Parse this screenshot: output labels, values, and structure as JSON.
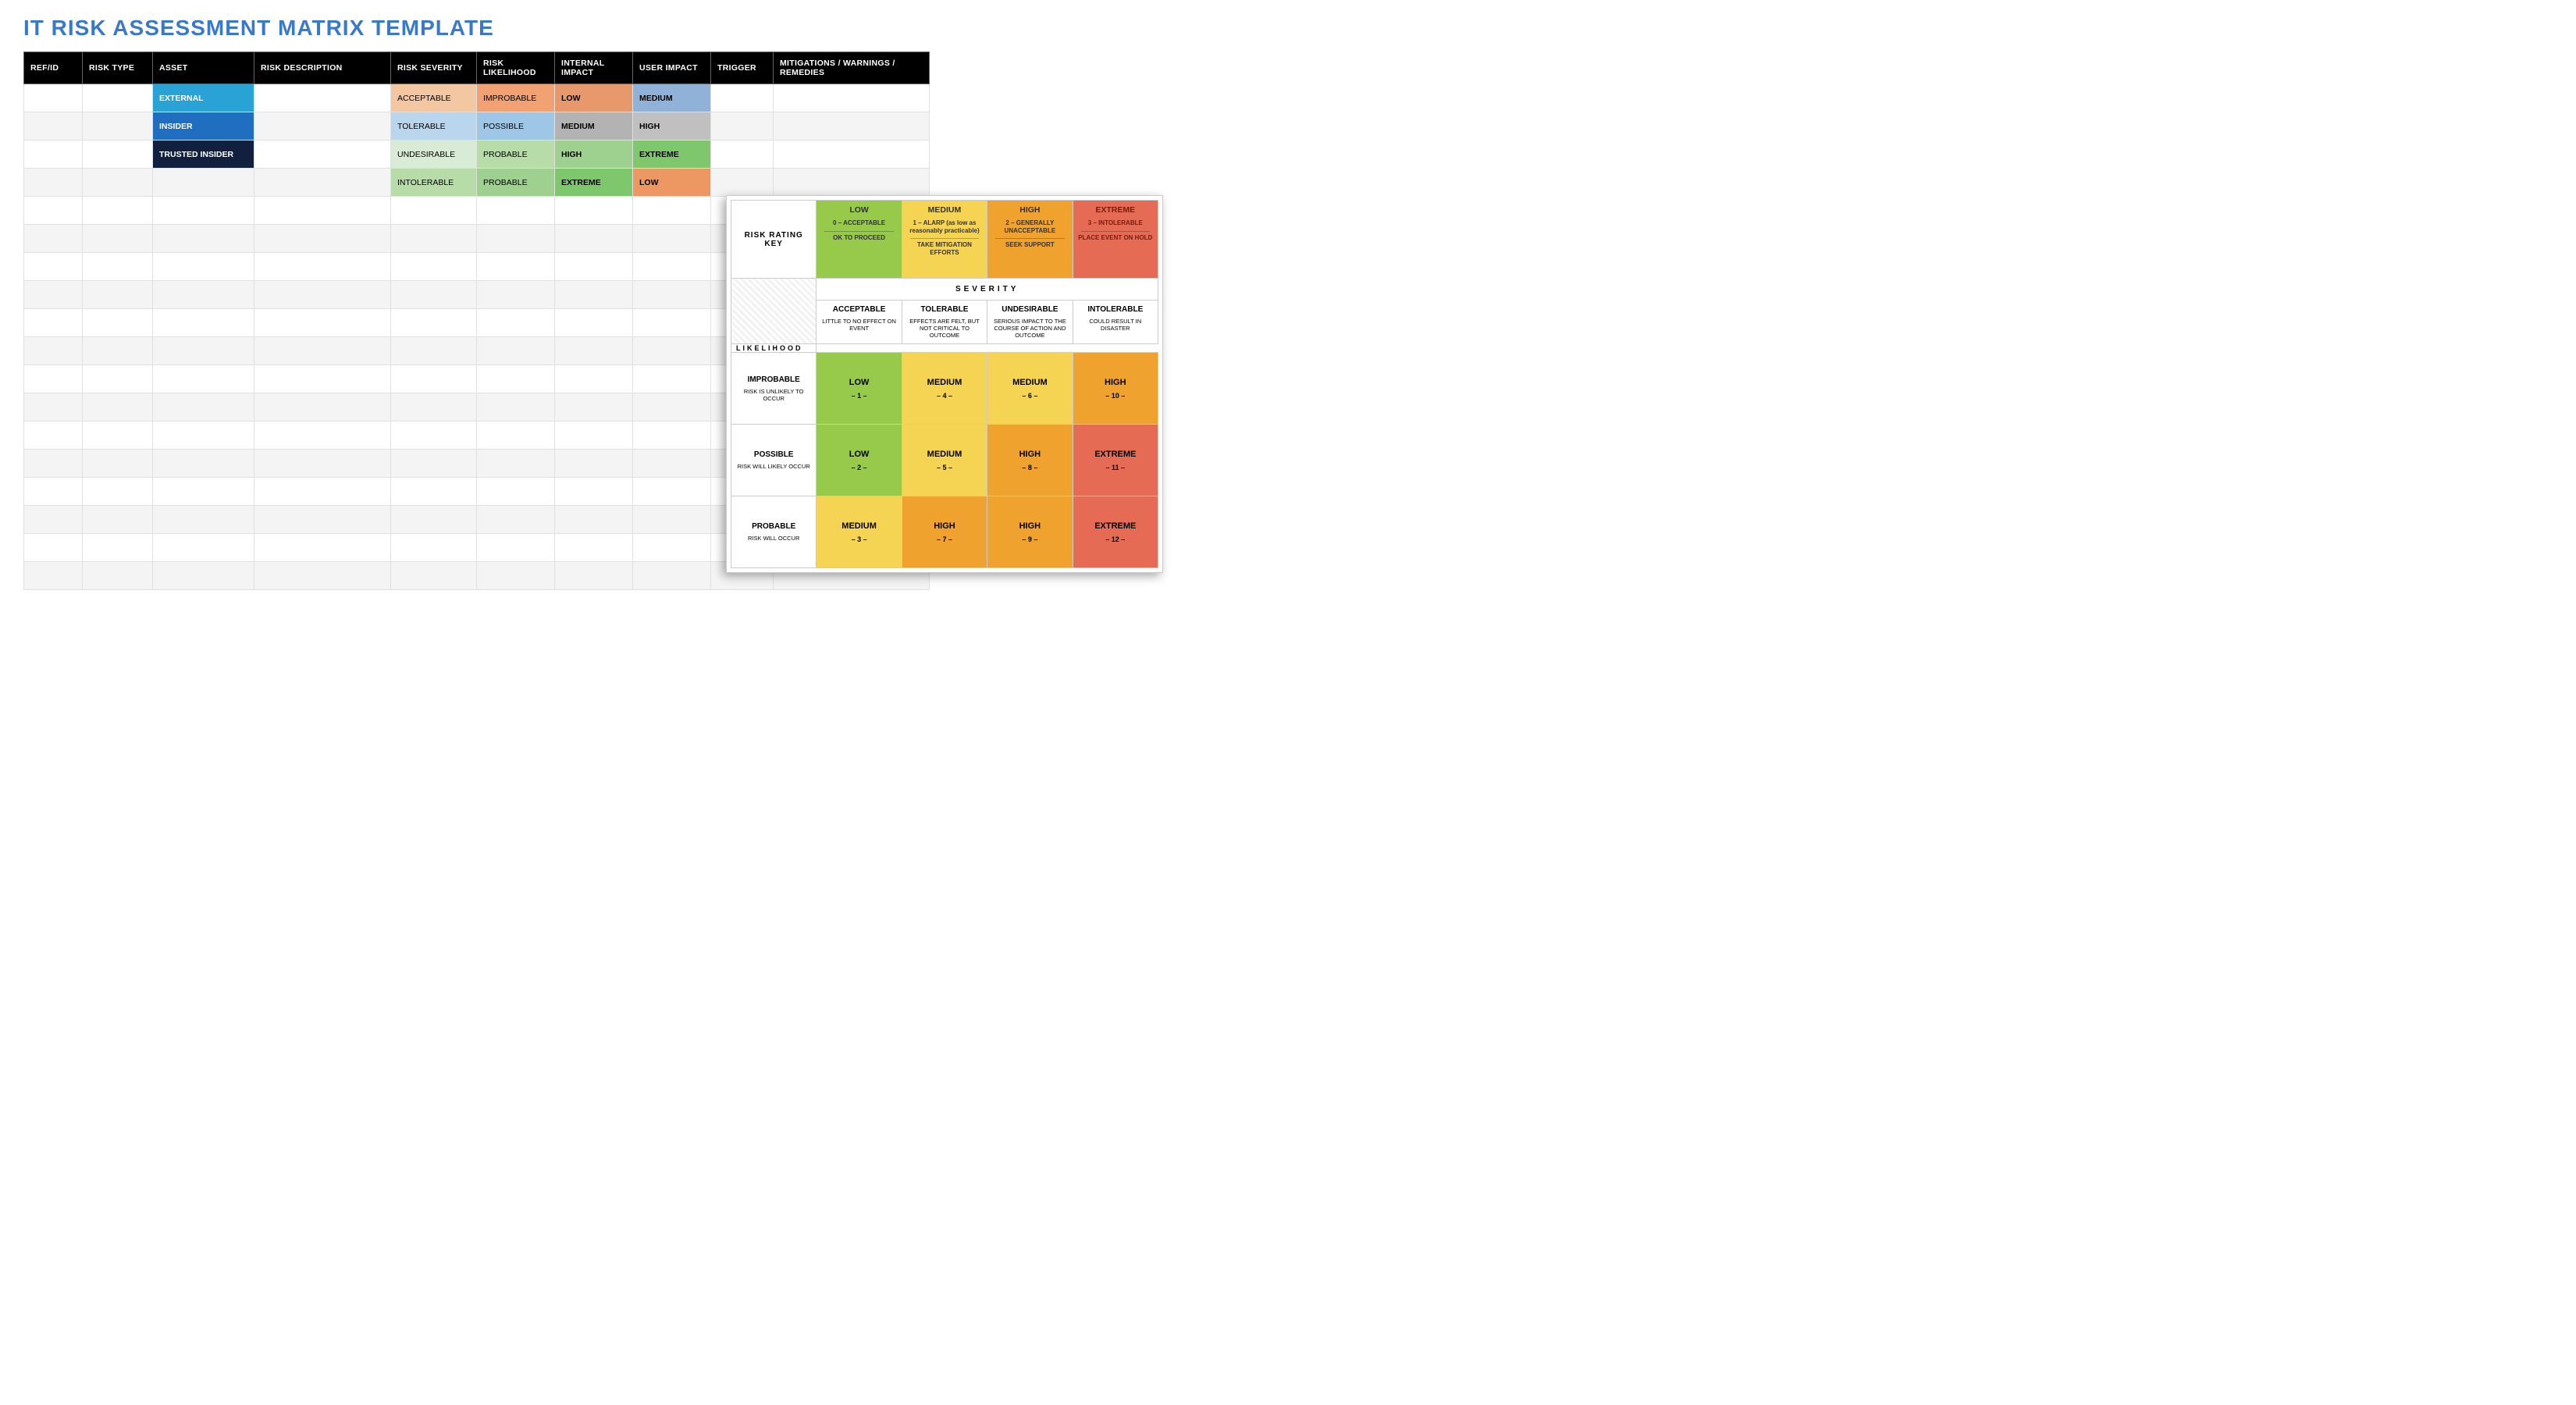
{
  "title": "IT RISK ASSESSMENT MATRIX TEMPLATE",
  "main_table": {
    "headers": [
      "REF/ID",
      "RISK TYPE",
      "ASSET",
      "RISK DESCRIPTION",
      "RISK SEVERITY",
      "RISK LIKELIHOOD",
      "INTERNAL IMPACT",
      "USER IMPACT",
      "TRIGGER",
      "MITIGATIONS / WARNINGS / REMEDIES"
    ],
    "rows": [
      {
        "asset": "EXTERNAL",
        "asset_cls": "asset-external",
        "severity": "ACCEPTABLE",
        "sev_cls": "sev-acceptable",
        "likelihood": "IMPROBABLE",
        "like_cls": "like-improbable",
        "internal": "LOW",
        "int_cls": "imp-low",
        "user": "MEDIUM",
        "user_cls": "user-medium"
      },
      {
        "asset": "INSIDER",
        "asset_cls": "asset-insider",
        "severity": "TOLERABLE",
        "sev_cls": "sev-tolerable",
        "likelihood": "POSSIBLE",
        "like_cls": "like-possible1",
        "internal": "MEDIUM",
        "int_cls": "imp-medium1",
        "user": "HIGH",
        "user_cls": "user-high"
      },
      {
        "asset": "TRUSTED INSIDER",
        "asset_cls": "asset-trusted",
        "severity": "UNDESIRABLE",
        "sev_cls": "sev-undesirable",
        "likelihood": "PROBABLE",
        "like_cls": "like-probable1",
        "internal": "HIGH",
        "int_cls": "imp-high1",
        "user": "EXTREME",
        "user_cls": "user-extreme"
      },
      {
        "asset": "",
        "asset_cls": "",
        "severity": "INTOLERABLE",
        "sev_cls": "sev-intolerable",
        "likelihood": "PROBABLE",
        "like_cls": "like-probable2",
        "internal": "EXTREME",
        "int_cls": "imp-extreme1",
        "user": "LOW",
        "user_cls": "user-low"
      }
    ],
    "empty_rows": 14
  },
  "legend": {
    "key_label": "RISK RATING KEY",
    "key_cells": [
      {
        "level": "LOW",
        "sub": "0 – ACCEPTABLE",
        "action": "OK TO PROCEED",
        "cls": "k-low"
      },
      {
        "level": "MEDIUM",
        "sub": "1 – ALARP (as low as reasonably practicable)",
        "action": "TAKE MITIGATION EFFORTS",
        "cls": "k-medium"
      },
      {
        "level": "HIGH",
        "sub": "2 – GENERALLY UNACCEPTABLE",
        "action": "SEEK SUPPORT",
        "cls": "k-high"
      },
      {
        "level": "EXTREME",
        "sub": "3 – INTOLERABLE",
        "action": "PLACE EVENT ON HOLD",
        "cls": "k-extreme"
      }
    ],
    "severity_label": "SEVERITY",
    "severity_cols": [
      {
        "label": "ACCEPTABLE",
        "desc": "LITTLE TO NO EFFECT ON EVENT"
      },
      {
        "label": "TOLERABLE",
        "desc": "EFFECTS ARE FELT, BUT NOT CRITICAL TO OUTCOME"
      },
      {
        "label": "UNDESIRABLE",
        "desc": "SERIOUS IMPACT TO THE COURSE OF ACTION AND OUTCOME"
      },
      {
        "label": "INTOLERABLE",
        "desc": "COULD RESULT IN DISASTER"
      }
    ],
    "likelihood_label": "LIKELIHOOD",
    "likelihood_rows": [
      {
        "label": "IMPROBABLE",
        "desc": "RISK IS UNLIKELY TO OCCUR",
        "cells": [
          {
            "level": "LOW",
            "score": "– 1 –",
            "cls": "low-c"
          },
          {
            "level": "MEDIUM",
            "score": "– 4 –",
            "cls": "med-c"
          },
          {
            "level": "MEDIUM",
            "score": "– 6 –",
            "cls": "med-c"
          },
          {
            "level": "HIGH",
            "score": "– 10 –",
            "cls": "high-c"
          }
        ]
      },
      {
        "label": "POSSIBLE",
        "desc": "RISK WILL LIKELY OCCUR",
        "cells": [
          {
            "level": "LOW",
            "score": "– 2 –",
            "cls": "low-c"
          },
          {
            "level": "MEDIUM",
            "score": "– 5 –",
            "cls": "med-c"
          },
          {
            "level": "HIGH",
            "score": "– 8 –",
            "cls": "high-c"
          },
          {
            "level": "EXTREME",
            "score": "– 11 –",
            "cls": "ext-c"
          }
        ]
      },
      {
        "label": "PROBABLE",
        "desc": "RISK WILL OCCUR",
        "cells": [
          {
            "level": "MEDIUM",
            "score": "– 3 –",
            "cls": "med-c"
          },
          {
            "level": "HIGH",
            "score": "– 7 –",
            "cls": "high-c"
          },
          {
            "level": "HIGH",
            "score": "– 9 –",
            "cls": "high-c"
          },
          {
            "level": "EXTREME",
            "score": "– 12 –",
            "cls": "ext-c"
          }
        ]
      }
    ]
  }
}
